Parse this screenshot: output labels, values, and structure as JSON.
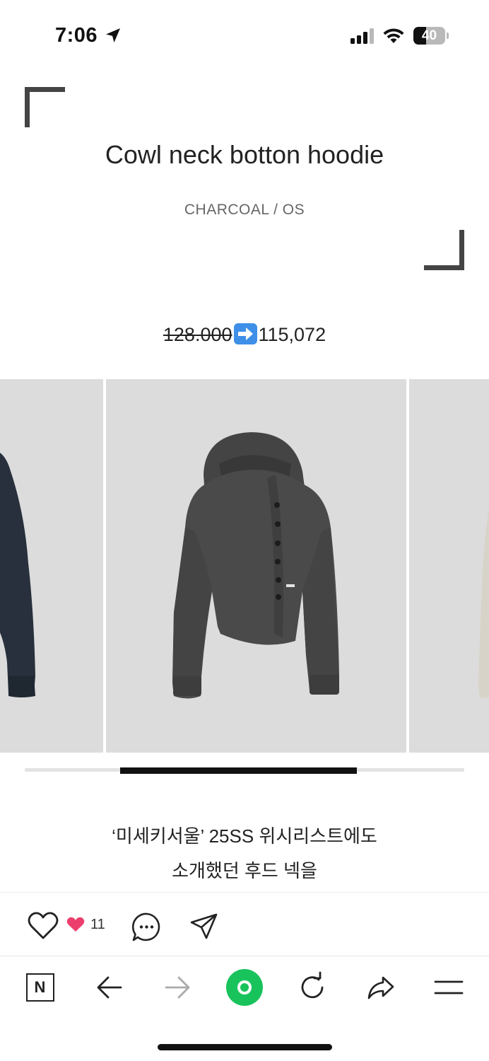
{
  "status_bar": {
    "time": "7:06",
    "battery_level": "40",
    "battery_fraction": 0.4,
    "icons": [
      "location-arrow-icon",
      "cellular-signal-icon",
      "wifi-icon",
      "battery-icon"
    ]
  },
  "product": {
    "title": "Cowl neck botton hoodie",
    "variant": "CHARCOAL / OS",
    "price_original": "128.000",
    "price_arrow_icon": "right-arrow-emoji-icon",
    "price_sale": "115,072"
  },
  "carousel": {
    "slides": [
      {
        "name": "navy-hoodie-image",
        "color": "#27303c"
      },
      {
        "name": "charcoal-hoodie-image",
        "color": "#4a4a4a"
      },
      {
        "name": "beige-hoodie-image",
        "color": "#d8d3c8"
      }
    ],
    "background": "#dcdcdc",
    "scroll_position_fraction": 0.54
  },
  "description": {
    "line1": "‘미세키서울’ 25SS 위시리스트에도",
    "line2": "소개했던 후드 넥을"
  },
  "actions": {
    "like_icon": "heart-outline-icon",
    "like_badge_icon": "pink-heart-icon",
    "like_count": "11",
    "comment_icon": "comment-bubble-icon",
    "send_icon": "paper-plane-icon"
  },
  "toolbar": {
    "home_label": "N",
    "items": [
      "naver-home-icon",
      "back-arrow-icon",
      "forward-arrow-icon",
      "green-search-icon",
      "reload-icon",
      "share-icon",
      "menu-icon"
    ],
    "accent": "#19c35c"
  }
}
